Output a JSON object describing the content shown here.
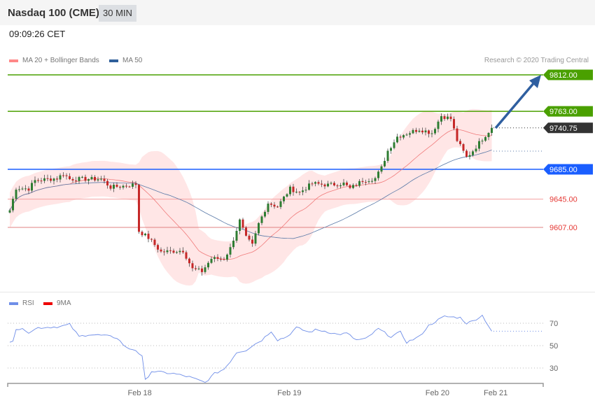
{
  "header": {
    "title": "Nasdaq 100 (CME)",
    "timeframe": "30 MIN",
    "time": "09:09:26 CET"
  },
  "legend": {
    "ma20": "MA 20 + Bollinger Bands",
    "ma50": "MA 50",
    "copyright": "Research © 2020 Trading Central",
    "rsi": "RSI",
    "rsi_ma": "9MA"
  },
  "colors": {
    "up": "#2e7d32",
    "down": "#c62828",
    "band": "#ffe0e0",
    "ma20": "#f07a7a",
    "ma50": "#5a7aa8",
    "green": "#4aa000",
    "blue": "#1a5eff",
    "red": "#e53935",
    "dark": "#333333",
    "arrow": "#2f5fa0",
    "rsi": "#6f8ee8"
  },
  "levels": [
    {
      "label": "9812.00",
      "price": 9812,
      "kind": "resistance"
    },
    {
      "label": "9763.00",
      "price": 9763,
      "kind": "resistance"
    },
    {
      "label": "9740.75",
      "price": 9740.75,
      "kind": "last"
    },
    {
      "label": "9685.00",
      "price": 9685,
      "kind": "pivot"
    },
    {
      "label": "9645.00",
      "price": 9645,
      "kind": "support"
    },
    {
      "label": "9607.00",
      "price": 9607,
      "kind": "support"
    }
  ],
  "chart_data": {
    "type": "candlestick",
    "price_range": [
      9502,
      9830
    ],
    "price_anchors": [
      [
        0,
        9630
      ],
      [
        2,
        9660
      ],
      [
        6,
        9659
      ],
      [
        8,
        9670
      ],
      [
        15,
        9673
      ],
      [
        17,
        9679
      ],
      [
        19,
        9672
      ],
      [
        24,
        9672
      ],
      [
        29,
        9672
      ],
      [
        32,
        9661
      ],
      [
        37,
        9663
      ],
      [
        40,
        9665
      ],
      [
        41,
        9602
      ],
      [
        44,
        9593
      ],
      [
        48,
        9574
      ],
      [
        55,
        9576
      ],
      [
        58,
        9551
      ],
      [
        61,
        9548
      ],
      [
        64,
        9565
      ],
      [
        68,
        9565
      ],
      [
        70,
        9579
      ],
      [
        73,
        9616
      ],
      [
        75,
        9593
      ],
      [
        77,
        9583
      ],
      [
        79,
        9612
      ],
      [
        82,
        9640
      ],
      [
        85,
        9635
      ],
      [
        89,
        9659
      ],
      [
        92,
        9654
      ],
      [
        96,
        9666
      ],
      [
        101,
        9664
      ],
      [
        106,
        9666
      ],
      [
        108,
        9659
      ],
      [
        112,
        9670
      ],
      [
        116,
        9673
      ],
      [
        118,
        9687
      ],
      [
        120,
        9710
      ],
      [
        123,
        9729
      ],
      [
        130,
        9739
      ],
      [
        134,
        9734
      ],
      [
        137,
        9757
      ],
      [
        140,
        9753
      ],
      [
        142,
        9724
      ],
      [
        145,
        9701
      ],
      [
        147,
        9710
      ],
      [
        150,
        9726
      ],
      [
        153,
        9740.75
      ]
    ],
    "rsi": {
      "levels": [
        70,
        50,
        30
      ],
      "anchors": [
        [
          0,
          54
        ],
        [
          1,
          55
        ],
        [
          2,
          65
        ],
        [
          5,
          64
        ],
        [
          6,
          62
        ],
        [
          9,
          66
        ],
        [
          16,
          67
        ],
        [
          19,
          69
        ],
        [
          22,
          58
        ],
        [
          25,
          60
        ],
        [
          30,
          59
        ],
        [
          34,
          57
        ],
        [
          37,
          48
        ],
        [
          40,
          46
        ],
        [
          42,
          40
        ],
        [
          43,
          19
        ],
        [
          45,
          27
        ],
        [
          52,
          25
        ],
        [
          57,
          22
        ],
        [
          62,
          17
        ],
        [
          65,
          25
        ],
        [
          68,
          29
        ],
        [
          70,
          36
        ],
        [
          72,
          44
        ],
        [
          75,
          46
        ],
        [
          77,
          50
        ],
        [
          80,
          55
        ],
        [
          83,
          63
        ],
        [
          85,
          55
        ],
        [
          88,
          58
        ],
        [
          91,
          66
        ],
        [
          95,
          62
        ],
        [
          97,
          64
        ],
        [
          100,
          63
        ],
        [
          104,
          60
        ],
        [
          107,
          61
        ],
        [
          110,
          55
        ],
        [
          113,
          56
        ],
        [
          117,
          65
        ],
        [
          121,
          58
        ],
        [
          124,
          62
        ],
        [
          126,
          53
        ],
        [
          130,
          58
        ],
        [
          133,
          68
        ],
        [
          136,
          73
        ],
        [
          138,
          76
        ],
        [
          143,
          75
        ],
        [
          145,
          70
        ],
        [
          147,
          72
        ],
        [
          150,
          77
        ],
        [
          153,
          63
        ],
        [
          155,
          52
        ],
        [
          158,
          42
        ],
        [
          160,
          36
        ],
        [
          163,
          46
        ],
        [
          166,
          52
        ],
        [
          169,
          58
        ],
        [
          172,
          60
        ]
      ]
    },
    "x_ticks": [
      {
        "label": "Feb 18",
        "index": 41
      },
      {
        "label": "Feb 19",
        "index": 88.5
      },
      {
        "label": "Feb 20",
        "index": 135.5
      },
      {
        "label": "Feb 21",
        "index": 154
      }
    ]
  }
}
